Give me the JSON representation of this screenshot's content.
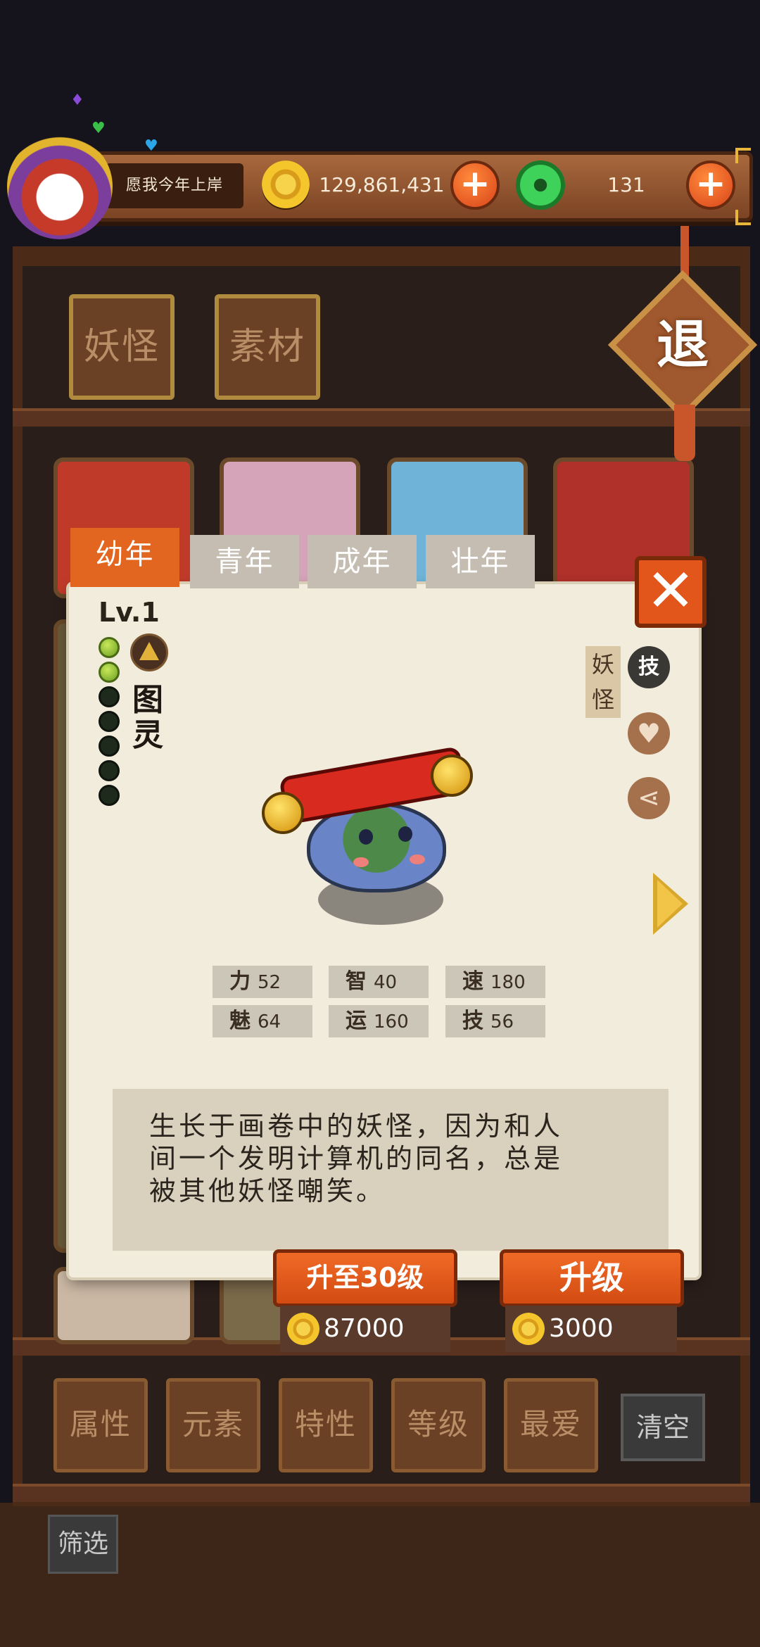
{
  "player": {
    "name": "愿我今年上岸",
    "coins": "129,861,431",
    "jade": "131"
  },
  "tabs_top": [
    "妖怪",
    "素材"
  ],
  "exit_label": "退",
  "age_tabs": [
    "幼年",
    "青年",
    "成年",
    "壮年"
  ],
  "active_age_index": 0,
  "monster": {
    "level": "Lv.1",
    "stars_total": 7,
    "stars_filled": 2,
    "name_chars": [
      "图",
      "灵"
    ],
    "kind_label": "妖怪",
    "skill_icon_label": "技",
    "element_icon": "earth-triangle-icon",
    "stats": [
      {
        "key": "力",
        "value": "52"
      },
      {
        "key": "智",
        "value": "40"
      },
      {
        "key": "速",
        "value": "180"
      },
      {
        "key": "魅",
        "value": "64"
      },
      {
        "key": "运",
        "value": "160"
      },
      {
        "key": "技",
        "value": "56"
      }
    ],
    "description_lines": [
      "生长于画卷中的妖怪，因为和人",
      "间一个发明计算机的同名，总是",
      "被其他妖怪嘲笑。"
    ]
  },
  "upgrade": {
    "to30_label": "升至30级",
    "to30_cost": "87000",
    "single_label": "升级",
    "single_cost": "3000"
  },
  "filter_tabs": [
    "属性",
    "元素",
    "特性",
    "等级",
    "最爱"
  ],
  "clear_label": "清空",
  "screen_label": "筛选",
  "colors": {
    "accent_orange": "#e2661f",
    "paper": "#f2ecdc",
    "wood": "#6b4126"
  }
}
